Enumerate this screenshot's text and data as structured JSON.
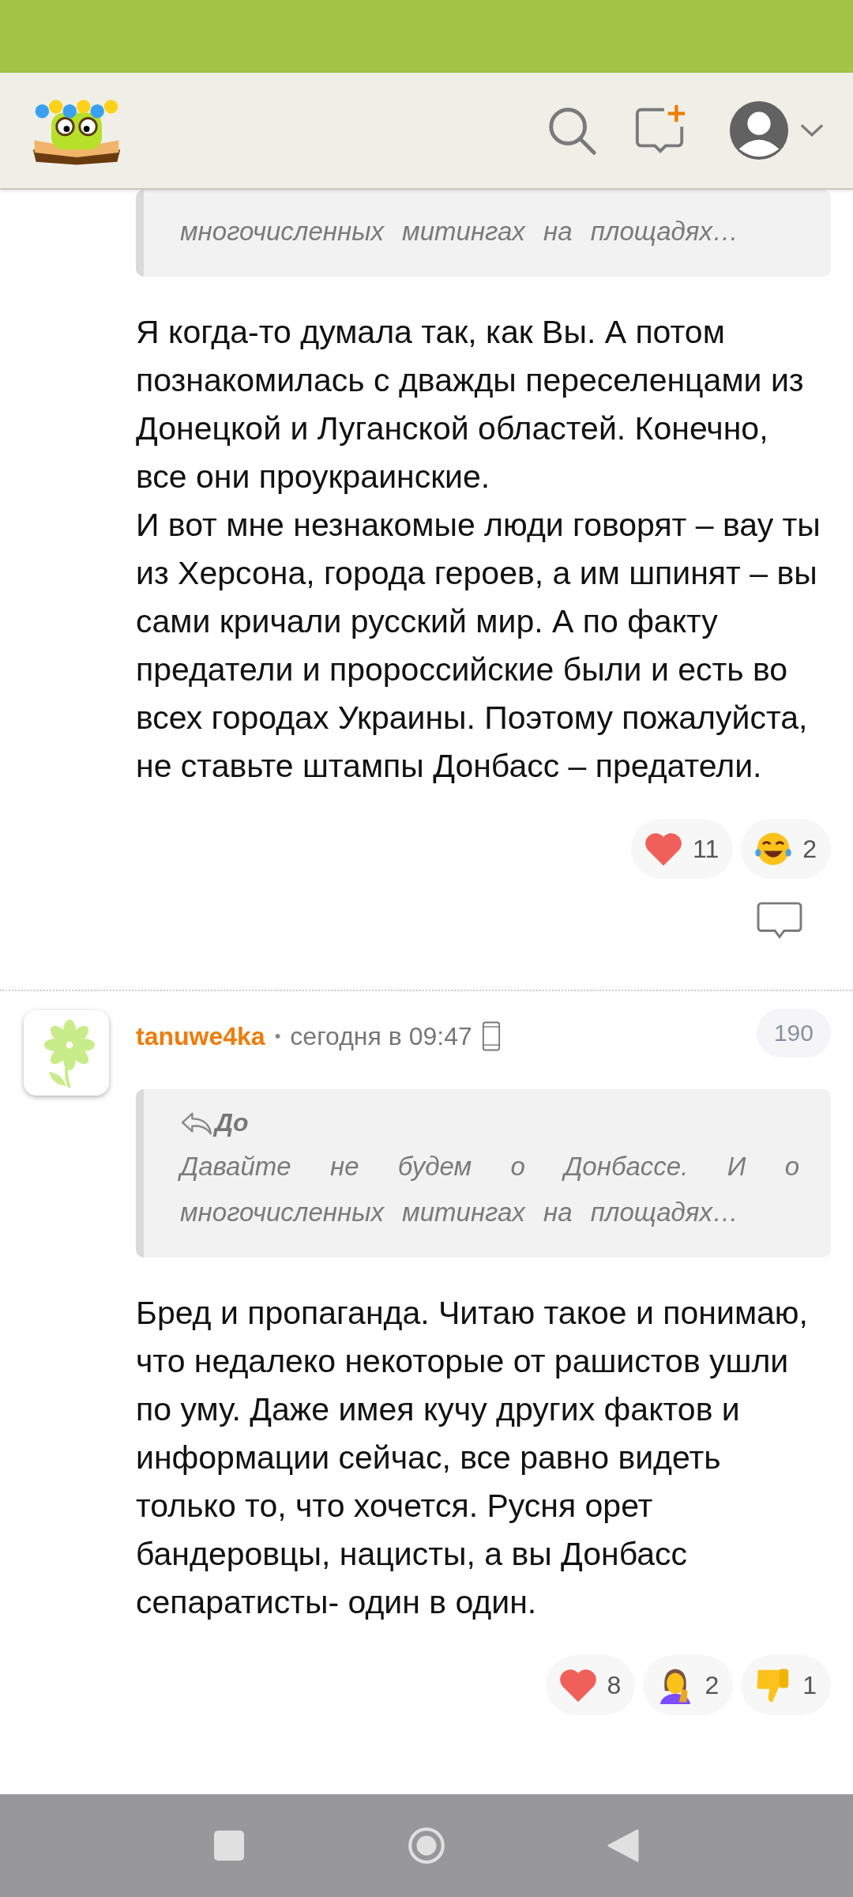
{
  "comments": [
    {
      "quote": {
        "text": "многочисленных митингах на площадях…"
      },
      "paragraphs": [
        "Я когда-то думала так, как Вы. А потом познакомилась с дважды переселенцами из Донецкой и Луганской областей. Конечно, все они проукраинские.",
        "И вот мне незнакомые люди говорят – вау ты из Херсона, города героев, а им шпинят – вы сами кричали русский мир. А по факту предатели и пророссийские были и есть во всех городах Украины. Поэтому пожалуйста, не ставьте штампы Донбасс – предатели."
      ],
      "reactions": [
        {
          "kind": "heart",
          "count": "11"
        },
        {
          "kind": "laugh",
          "count": "2"
        }
      ]
    },
    {
      "author": "tanuwe4ka",
      "separator": "•",
      "time": "сегодня в 09:47",
      "number": "190",
      "quote": {
        "reply_to": "До",
        "text": "Давайте не будем о Донбассе. И о многочисленных митингах на площадях…"
      },
      "paragraphs": [
        "Бред и пропаганда. Читаю такое и понимаю, что недалеко некоторые от рашистов ушли по уму. Даже имея кучу других фактов и информации сейчас, все равно видеть только то, что хочется. Русня орет бандеровцы, нацисты, а вы Донбасс сепаратисты- один в один."
      ],
      "reactions": [
        {
          "kind": "heart",
          "count": "8"
        },
        {
          "kind": "facepalm",
          "count": "2"
        },
        {
          "kind": "dislike",
          "count": "1"
        }
      ]
    }
  ]
}
